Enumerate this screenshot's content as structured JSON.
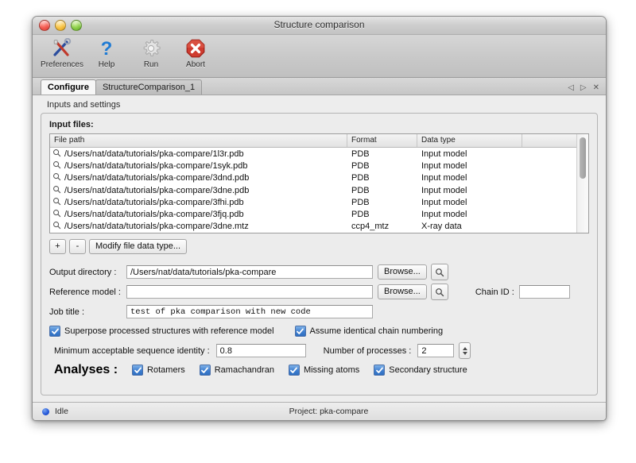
{
  "window": {
    "title": "Structure comparison",
    "controls": [
      "close",
      "minimize",
      "zoom"
    ]
  },
  "toolbar": {
    "items": [
      {
        "label": "Preferences",
        "icon": "tools-icon"
      },
      {
        "label": "Help",
        "icon": "question-mark-icon"
      },
      {
        "label": "Run",
        "icon": "gear-icon"
      },
      {
        "label": "Abort",
        "icon": "stop-x-icon"
      }
    ]
  },
  "tabs": {
    "items": [
      {
        "label": "Configure",
        "active": true
      },
      {
        "label": "StructureComparison_1",
        "active": false
      }
    ],
    "controls": [
      "prev-icon",
      "next-icon",
      "close-icon"
    ]
  },
  "section": {
    "title": "Inputs and settings"
  },
  "input_files": {
    "label": "Input files:",
    "columns": [
      "File path",
      "Format",
      "Data type",
      ""
    ],
    "rows": [
      {
        "path": "/Users/nat/data/tutorials/pka-compare/1l3r.pdb",
        "format": "PDB",
        "type": "Input model"
      },
      {
        "path": "/Users/nat/data/tutorials/pka-compare/1syk.pdb",
        "format": "PDB",
        "type": "Input model"
      },
      {
        "path": "/Users/nat/data/tutorials/pka-compare/3dnd.pdb",
        "format": "PDB",
        "type": "Input model"
      },
      {
        "path": "/Users/nat/data/tutorials/pka-compare/3dne.pdb",
        "format": "PDB",
        "type": "Input model"
      },
      {
        "path": "/Users/nat/data/tutorials/pka-compare/3fhi.pdb",
        "format": "PDB",
        "type": "Input model"
      },
      {
        "path": "/Users/nat/data/tutorials/pka-compare/3fjq.pdb",
        "format": "PDB",
        "type": "Input model"
      },
      {
        "path": "/Users/nat/data/tutorials/pka-compare/3dne.mtz",
        "format": "ccp4_mtz",
        "type": "X-ray data"
      }
    ]
  },
  "file_buttons": {
    "add": "+",
    "remove": "-",
    "modify": "Modify file data type..."
  },
  "form": {
    "output_directory": {
      "label": "Output directory :",
      "value": "/Users/nat/data/tutorials/pka-compare",
      "browse": "Browse..."
    },
    "reference_model": {
      "label": "Reference model :",
      "value": "",
      "browse": "Browse..."
    },
    "chain_id": {
      "label": "Chain ID :",
      "value": ""
    },
    "job_title": {
      "label": "Job title :",
      "value": "test of pka comparison with new code"
    }
  },
  "options": {
    "superpose": {
      "label": "Superpose processed structures with reference model",
      "checked": true
    },
    "identical_chains": {
      "label": "Assume identical chain numbering",
      "checked": true
    },
    "min_identity": {
      "label": "Minimum acceptable sequence identity :",
      "value": "0.8"
    },
    "num_processes": {
      "label": "Number of processes :",
      "value": "2"
    }
  },
  "analyses": {
    "label": "Analyses :",
    "items": [
      {
        "label": "Rotamers",
        "checked": true
      },
      {
        "label": "Ramachandran",
        "checked": true
      },
      {
        "label": "Missing atoms",
        "checked": true
      },
      {
        "label": "Secondary structure",
        "checked": true
      }
    ]
  },
  "status": {
    "state": "Idle",
    "project": "Project: pka-compare"
  },
  "colors": {
    "accent_blue": "#2e6ec0",
    "status_dot": "#2255d8",
    "abort_red": "#c4322a"
  }
}
